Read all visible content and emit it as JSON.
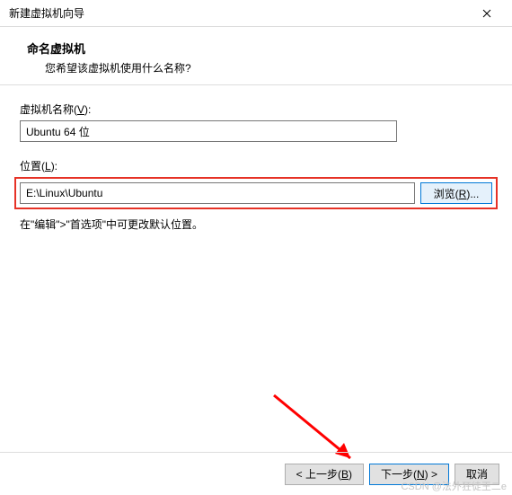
{
  "titlebar": {
    "title": "新建虚拟机向导"
  },
  "header": {
    "title": "命名虚拟机",
    "subtitle": "您希望该虚拟机使用什么名称?"
  },
  "form": {
    "name_label_pre": "虚拟机名称(",
    "name_label_u": "V",
    "name_label_post": "):",
    "name_value": "Ubuntu 64 位",
    "loc_label_pre": "位置(",
    "loc_label_u": "L",
    "loc_label_post": "):",
    "loc_value": "E:\\Linux\\Ubuntu",
    "browse_pre": "浏览(",
    "browse_u": "R",
    "browse_post": ")...",
    "hint": "在\"编辑\">\"首选项\"中可更改默认位置。"
  },
  "footer": {
    "back_pre": "< 上一步(",
    "back_u": "B",
    "back_post": ")",
    "next_pre": "下一步(",
    "next_u": "N",
    "next_post": ") >",
    "cancel": "取消"
  },
  "watermark": "CSDN @法外狂徒王二e"
}
